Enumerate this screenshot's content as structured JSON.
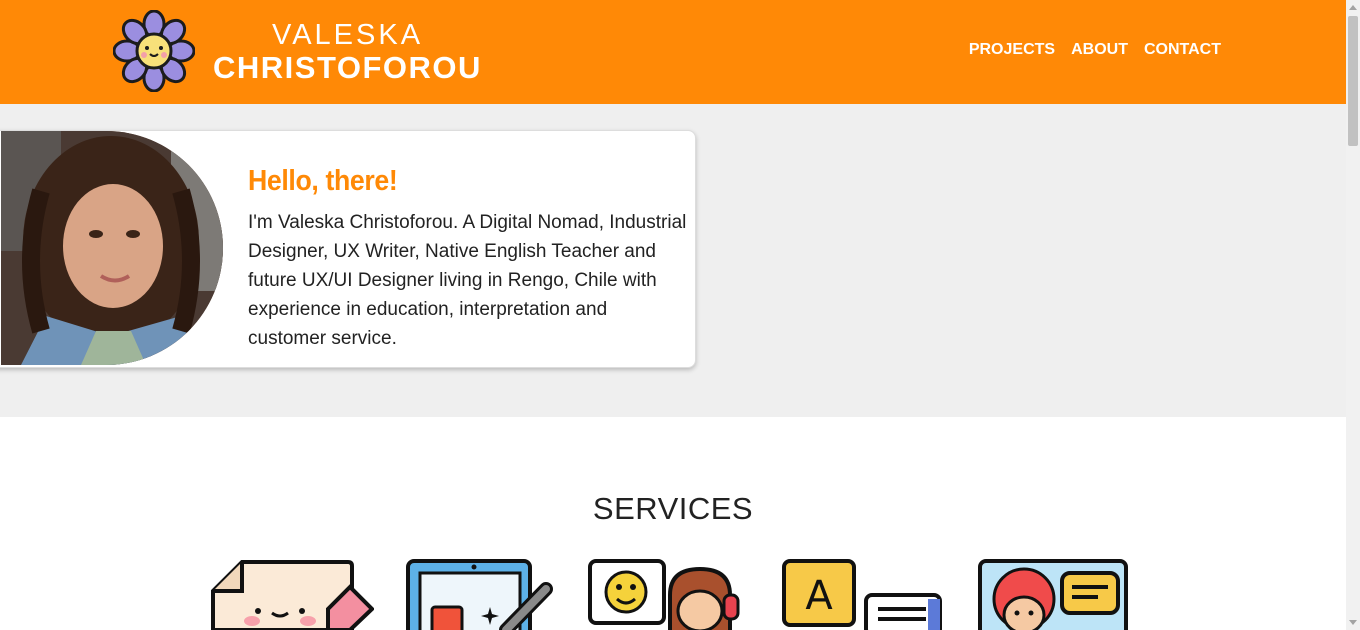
{
  "header": {
    "brand_first": "VALESKA",
    "brand_last": "CHRISTOFOROU",
    "logo_icon": "flower-logo-icon",
    "nav": [
      {
        "label": "PROJECTS"
      },
      {
        "label": "ABOUT"
      },
      {
        "label": "CONTACT"
      }
    ]
  },
  "intro": {
    "title": "Hello, there!",
    "text": "I'm Valeska Christoforou. A Digital Nomad, Industrial Designer, UX Writer, Native English Teacher and future UX/UI Designer living in Rengo, Chile with experience in education, interpretation and customer service."
  },
  "services": {
    "title": "SERVICES",
    "icons": [
      "writing-icon",
      "tablet-design-icon",
      "customer-service-icon",
      "translation-icon",
      "video-teaching-icon"
    ]
  },
  "colors": {
    "accent": "#ff8906",
    "background": "#efefef"
  }
}
